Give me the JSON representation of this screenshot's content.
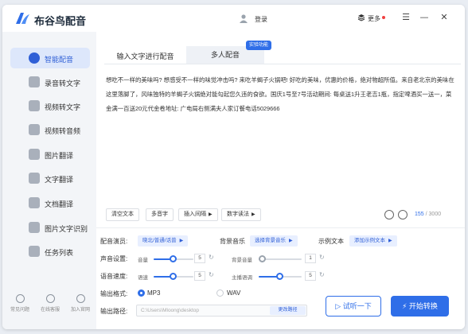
{
  "app": {
    "title": "布谷鸟配音",
    "login": "登录",
    "more": "更多",
    "colors": {
      "accent": "#2f6ee8",
      "sidebar_bg": "#f3f5f8",
      "active_bg": "#dde7fb",
      "more_dot": "#f04040"
    }
  },
  "sidebar": {
    "items": [
      {
        "label": "智能配音",
        "icon": "mic-icon",
        "active": true
      },
      {
        "label": "录音转文字",
        "icon": "recording-icon"
      },
      {
        "label": "视频转文字",
        "icon": "video-icon"
      },
      {
        "label": "视频转音频",
        "icon": "video-audio-icon"
      },
      {
        "label": "图片翻译",
        "icon": "image-icon"
      },
      {
        "label": "文字翻译",
        "icon": "translate-icon"
      },
      {
        "label": "文档翻译",
        "icon": "document-icon"
      },
      {
        "label": "图片文字识别",
        "icon": "ocr-icon"
      },
      {
        "label": "任务列表",
        "icon": "task-list-icon"
      }
    ],
    "bottom": [
      {
        "label": "常见问题",
        "icon": "question-icon"
      },
      {
        "label": "在线客服",
        "icon": "chat-icon"
      },
      {
        "label": "加入官网",
        "icon": "home-icon"
      }
    ]
  },
  "tabs": [
    {
      "label": "输入文字进行配音"
    },
    {
      "label": "多人配音"
    }
  ],
  "badge": "实验功能",
  "text_content": "想吃不一样的美味吗? 想感受不一样的味觉冲击吗? 来吃羊蝎子火锅吧! 好吃的美味，优惠的价格，绝对物超所值。来自老北京的美味在这里落脚了，风味独特的羊蝎子火锅绝对能勾起您久违的食欲。国庆1号至7号活动期间: 每桌送1升王老吉1瓶，指定啤酒买一送一，菜金满一百送20元代金卷地址: 广电局右侧满夫人家订餐电话5029666",
  "toolbar": {
    "clear": "清空文本",
    "polyphone": "多音字",
    "pause": "插入间隔",
    "digits": "数字读法",
    "count": "155",
    "limit": "/ 3000"
  },
  "settings": {
    "voice_label": "配音演员:",
    "voice_value": "晓北/普通/话普",
    "music_label": "背景音乐",
    "music_value": "选择背景音乐",
    "example_label": "示例文本",
    "example_value": "添加示例文本",
    "volume_label": "声音设置:",
    "volume_slider_label": "音量",
    "volume_value": "5",
    "volume_level": 0.5,
    "bg_volume_label": "背景音量",
    "bg_volume_value": "1",
    "bg_volume_level": 0.1,
    "speed_label": "语音速度:",
    "speed_slider_label": "语速",
    "speed_value": "5",
    "speed_level": 0.5,
    "pitch_label": "主播语调",
    "pitch_value": "5",
    "pitch_level": 0.5,
    "format_label": "输出格式:",
    "format_mp3": "MP3",
    "format_wav": "WAV",
    "format_selected": "MP3",
    "path_label": "输出路径:",
    "path_value": "C:\\Users\\Mloong\\desktop",
    "path_button": "更改路径"
  },
  "actions": {
    "listen": "试听一下",
    "convert": "开始转换"
  }
}
